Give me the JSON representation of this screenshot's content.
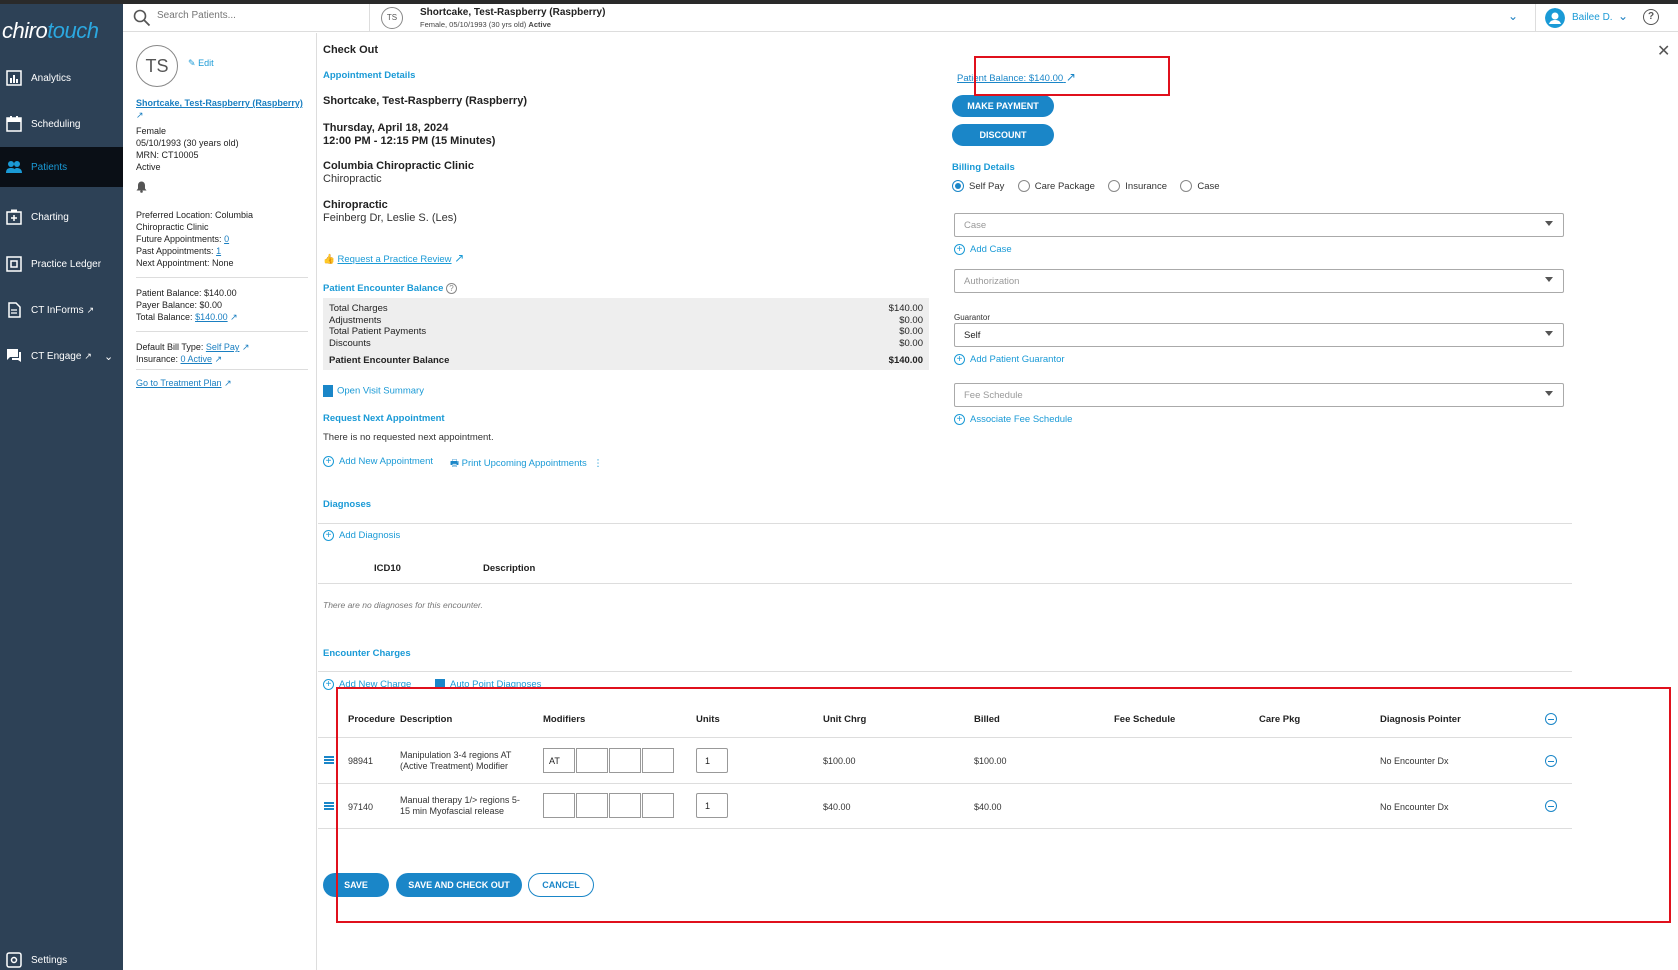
{
  "app": {
    "logo_a": "chiro",
    "logo_b": "touch"
  },
  "sidebar": {
    "items": [
      {
        "label": "Analytics",
        "icon": "chart-icon"
      },
      {
        "label": "Scheduling",
        "icon": "calendar-icon"
      },
      {
        "label": "Patients",
        "icon": "people-icon"
      },
      {
        "label": "Charting",
        "icon": "charting-icon"
      },
      {
        "label": "Practice Ledger",
        "icon": "ledger-icon"
      },
      {
        "label": "CT InForms",
        "icon": "document-icon"
      },
      {
        "label": "CT Engage",
        "icon": "chat-icon"
      },
      {
        "label": "Settings",
        "icon": "settings-icon"
      }
    ]
  },
  "header": {
    "search_placeholder": "Search Patients...",
    "avatar_initials": "TS",
    "patient_name": "Shortcake, Test-Raspberry (Raspberry)",
    "patient_sub": "Female, 05/10/1993 (30 yrs old)",
    "patient_status": "Active",
    "user_name": "Bailee D.",
    "help": "?"
  },
  "patient_panel": {
    "initials": "TS",
    "edit": "Edit",
    "name": "Shortcake, Test-Raspberry (Raspberry)",
    "sex": "Female",
    "dob": "05/10/1993 (30 years old)",
    "mrn": "MRN: CT10005",
    "status": "Active",
    "preferred_location_1": "Preferred Location: Columbia",
    "preferred_location_2": "Chiropractic Clinic",
    "future_appts": "Future Appointments:",
    "future_appts_val": "0",
    "past_appts": "Past Appointments:",
    "past_appts_val": "1",
    "next_appt": "Next Appointment: None",
    "patient_balance": "Patient Balance: $140.00",
    "payer_balance": "Payer Balance: $0.00",
    "total_balance": "Total Balance:",
    "total_balance_val": "$140.00",
    "bill_type": "Default Bill Type:",
    "bill_type_val": "Self Pay",
    "insurance": "Insurance:",
    "insurance_val": "0 Active",
    "treatment_plan": "Go to Treatment Plan"
  },
  "checkout": {
    "title": "Check Out",
    "appt_details": "Appointment Details",
    "patient": "Shortcake, Test-Raspberry (Raspberry)",
    "date": "Thursday, April 18, 2024",
    "time": "12:00 PM - 12:15 PM (15 Minutes)",
    "clinic": "Columbia Chiropractic Clinic",
    "clinic_type": "Chiropractic",
    "provider_type": "Chiropractic",
    "provider": "Feinberg Dr, Leslie S. (Les)",
    "practice_review": "Request a Practice Review",
    "encounter_balance_title": "Patient Encounter Balance",
    "balance_rows": [
      {
        "label": "Total Charges",
        "value": "$140.00"
      },
      {
        "label": "Adjustments",
        "value": "$0.00"
      },
      {
        "label": "Total Patient Payments",
        "value": "$0.00"
      },
      {
        "label": "Discounts",
        "value": "$0.00"
      }
    ],
    "balance_total_label": "Patient Encounter Balance",
    "balance_total_value": "$140.00",
    "open_visit_summary": "Open Visit Summary",
    "next_appt_title": "Request Next Appointment",
    "next_appt_text": "There is no requested next appointment.",
    "add_new_appt": "Add New Appointment",
    "print_upcoming": "Print Upcoming Appointments",
    "diagnoses_title": "Diagnoses",
    "add_diagnosis": "Add Diagnosis",
    "dx_col_icd": "ICD10",
    "dx_col_desc": "Description",
    "dx_empty": "There are no diagnoses for this encounter."
  },
  "billing": {
    "patient_balance_link": "Patient Balance: $140.00",
    "make_payment": "MAKE PAYMENT",
    "discount": "DISCOUNT",
    "details_title": "Billing Details",
    "radio_options": [
      "Self Pay",
      "Care Package",
      "Insurance",
      "Case"
    ],
    "selected": "Self Pay",
    "case_placeholder": "Case",
    "add_case": "Add Case",
    "authorization_placeholder": "Authorization",
    "guarantor_label": "Guarantor",
    "guarantor_value": "Self",
    "add_guarantor": "Add Patient Guarantor",
    "fee_schedule_placeholder": "Fee Schedule",
    "associate_fee": "Associate Fee Schedule"
  },
  "charges": {
    "title": "Encounter Charges",
    "add_new_charge": "Add New Charge",
    "auto_point": "Auto Point Diagnoses",
    "columns": [
      "Procedure",
      "Description",
      "Modifiers",
      "Units",
      "Unit Chrg",
      "Billed",
      "Fee Schedule",
      "Care Pkg",
      "Diagnosis Pointer"
    ],
    "rows": [
      {
        "procedure": "98941",
        "desc1": "Manipulation 3-4 regions AT",
        "desc2": "(Active Treatment) Modifier",
        "mods": [
          "AT",
          "",
          "",
          ""
        ],
        "units": "1",
        "unit_chrg": "$100.00",
        "billed": "$100.00",
        "dx": "No Encounter Dx"
      },
      {
        "procedure": "97140",
        "desc1": "Manual therapy 1/> regions 5-",
        "desc2": "15 min Myofascial release",
        "mods": [
          "",
          "",
          "",
          ""
        ],
        "units": "1",
        "unit_chrg": "$40.00",
        "billed": "$40.00",
        "dx": "No Encounter Dx"
      }
    ]
  },
  "footer": {
    "save": "SAVE",
    "save_checkout": "SAVE AND CHECK OUT",
    "cancel": "CANCEL"
  },
  "colors": {
    "sidebar": "#2d4156",
    "accent": "#1a9ad6",
    "button": "#1a86c8",
    "highlight": "#e0101c"
  }
}
